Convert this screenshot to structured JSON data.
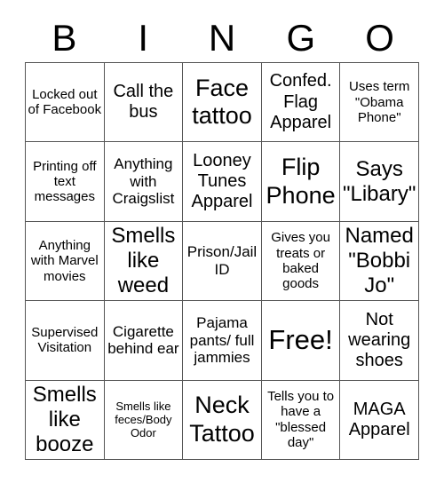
{
  "card": {
    "header_letters": [
      "B",
      "I",
      "N",
      "G",
      "O"
    ],
    "grid": {
      "rows": 5,
      "columns": 5,
      "border_color": "#555555",
      "background_color": "#ffffff",
      "text_color": "#000000"
    },
    "cells": [
      {
        "text": "Locked out of Facebook",
        "size": "sz-s"
      },
      {
        "text": "Call the bus",
        "size": "sz-l"
      },
      {
        "text": "Face tattoo",
        "size": "sz-xxl"
      },
      {
        "text": "Confed. Flag Apparel",
        "size": "sz-l"
      },
      {
        "text": "Uses term \"Obama Phone\"",
        "size": "sz-s"
      },
      {
        "text": "Printing off text messages",
        "size": "sz-s"
      },
      {
        "text": "Anything with Craigslist",
        "size": "sz-m"
      },
      {
        "text": "Looney Tunes Apparel",
        "size": "sz-l"
      },
      {
        "text": "Flip Phone",
        "size": "sz-xxl"
      },
      {
        "text": "Says \"Libary\"",
        "size": "sz-xl"
      },
      {
        "text": "Anything with Marvel movies",
        "size": "sz-s"
      },
      {
        "text": "Smells like weed",
        "size": "sz-xl"
      },
      {
        "text": "Prison/Jail ID",
        "size": "sz-m"
      },
      {
        "text": "Gives you treats or baked goods",
        "size": "sz-s"
      },
      {
        "text": "Named \"Bobbi Jo\"",
        "size": "sz-xl"
      },
      {
        "text": "Supervised Visitation",
        "size": "sz-s"
      },
      {
        "text": "Cigarette behind ear",
        "size": "sz-m"
      },
      {
        "text": "Pajama pants/ full jammies",
        "size": "sz-m"
      },
      {
        "text": "Free!",
        "size": "sz-free"
      },
      {
        "text": "Not wearing shoes",
        "size": "sz-l"
      },
      {
        "text": "Smells like booze",
        "size": "sz-xl"
      },
      {
        "text": "Smells like feces/Body Odor",
        "size": "sz-xs"
      },
      {
        "text": "Neck Tattoo",
        "size": "sz-xxl"
      },
      {
        "text": "Tells you to have a \"blessed day\"",
        "size": "sz-s"
      },
      {
        "text": "MAGA Apparel",
        "size": "sz-l"
      }
    ]
  }
}
